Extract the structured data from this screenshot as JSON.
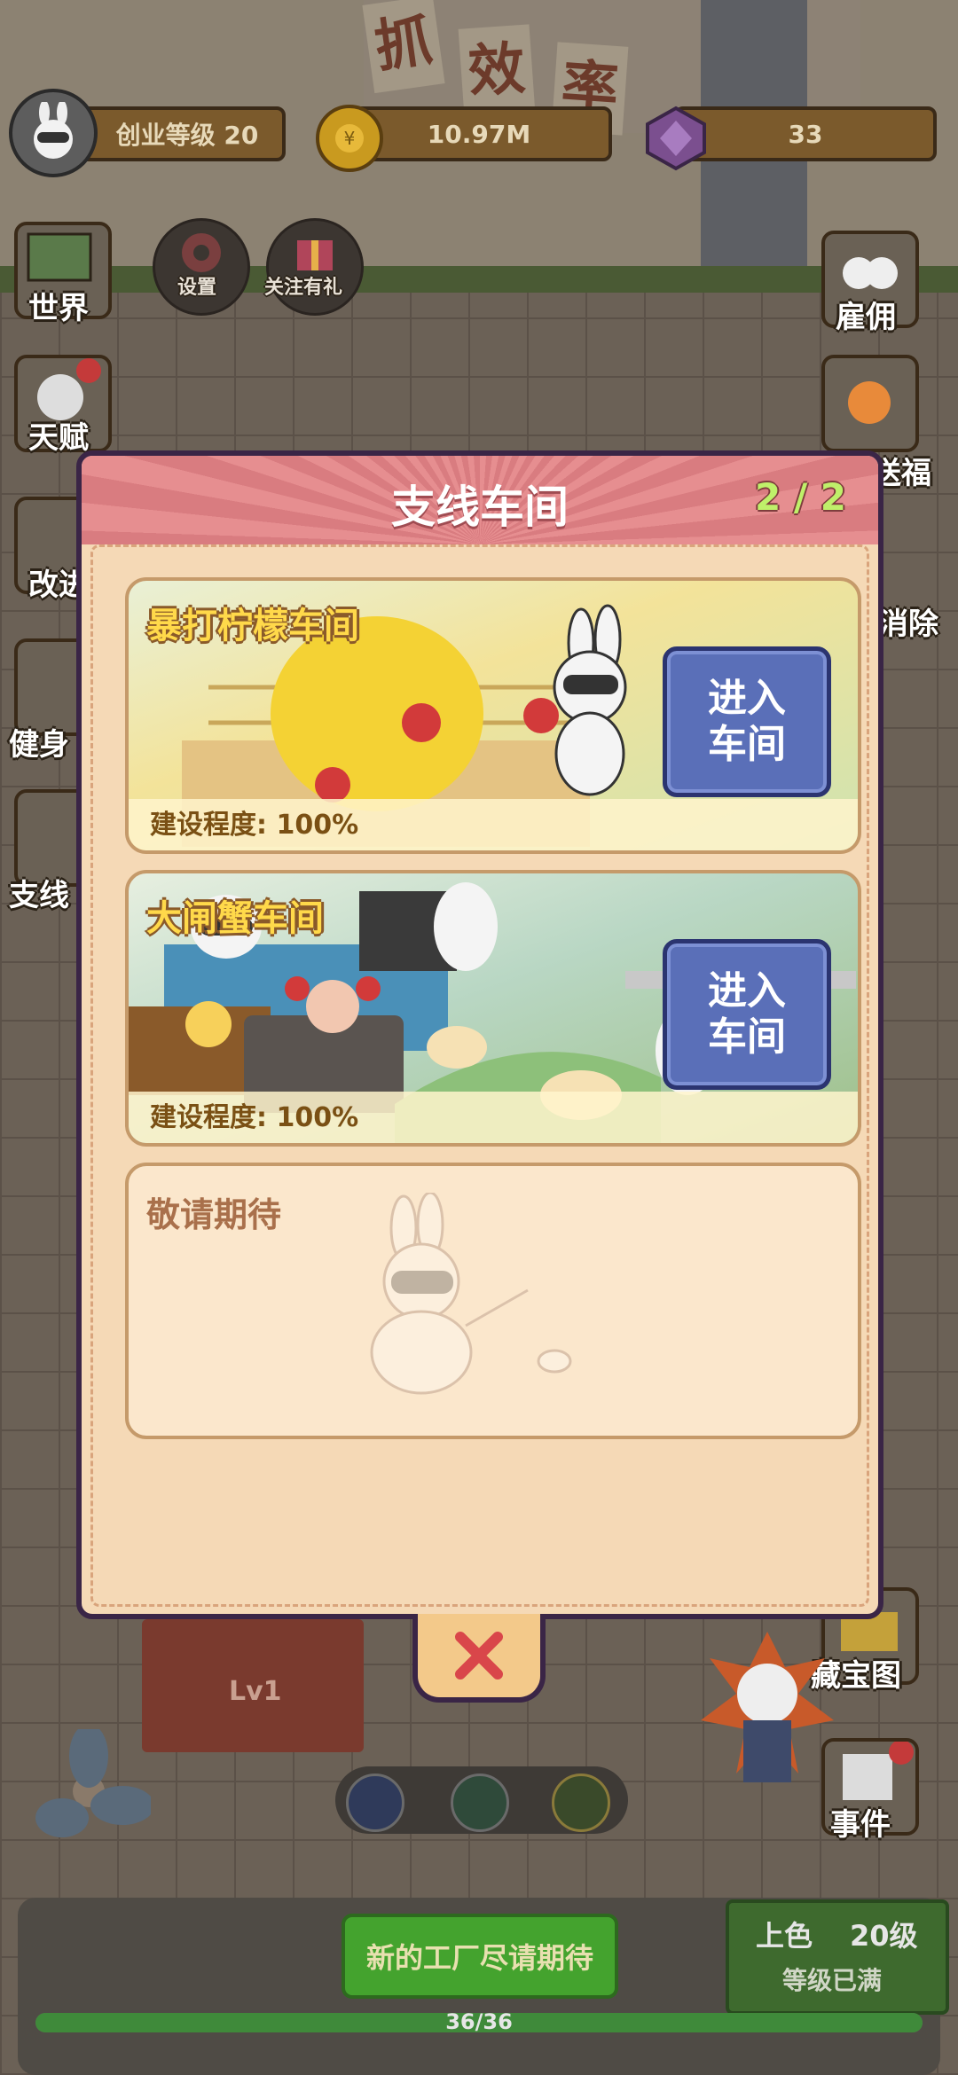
{
  "top_bar": {
    "level_label": "创业等级 20",
    "coins": "10.97M",
    "gems": "33"
  },
  "banner": {
    "chars": [
      "抓",
      "效",
      "率"
    ]
  },
  "left_menu": {
    "world": "世界",
    "talent": "天赋",
    "improve": "改进",
    "fitness": "健身",
    "branch": "支线"
  },
  "top_round": {
    "settings": "设置",
    "follow": "关注有礼"
  },
  "right_menu": {
    "hire": "雇佣",
    "bless": "送福",
    "eliminate": "消除",
    "treasure_map": "藏宝图",
    "events": "事件"
  },
  "modal": {
    "title": "支线车间",
    "count": "2 / 2",
    "workshops": [
      {
        "name": "暴打柠檬车间",
        "progress": "建设程度: 100%",
        "button": [
          "进入",
          "车间"
        ]
      },
      {
        "name": "大闸蟹车间",
        "progress": "建设程度: 100%",
        "button": [
          "进入",
          "车间"
        ]
      }
    ],
    "coming_soon": "敬请期待"
  },
  "scene": {
    "station_level": "Lv1"
  },
  "bottom": {
    "new_factory": "新的工厂尽请期待",
    "progress": "36/36",
    "progress_fraction": 1.0,
    "upgrade_name": "上色",
    "upgrade_level": "20级",
    "upgrade_status": "等级已满"
  },
  "colors": {
    "modal_bg": "#f5d9b6",
    "header_red": "#e38d8f",
    "enter_button": "#5a6fb8",
    "count_green": "#bff06a"
  }
}
